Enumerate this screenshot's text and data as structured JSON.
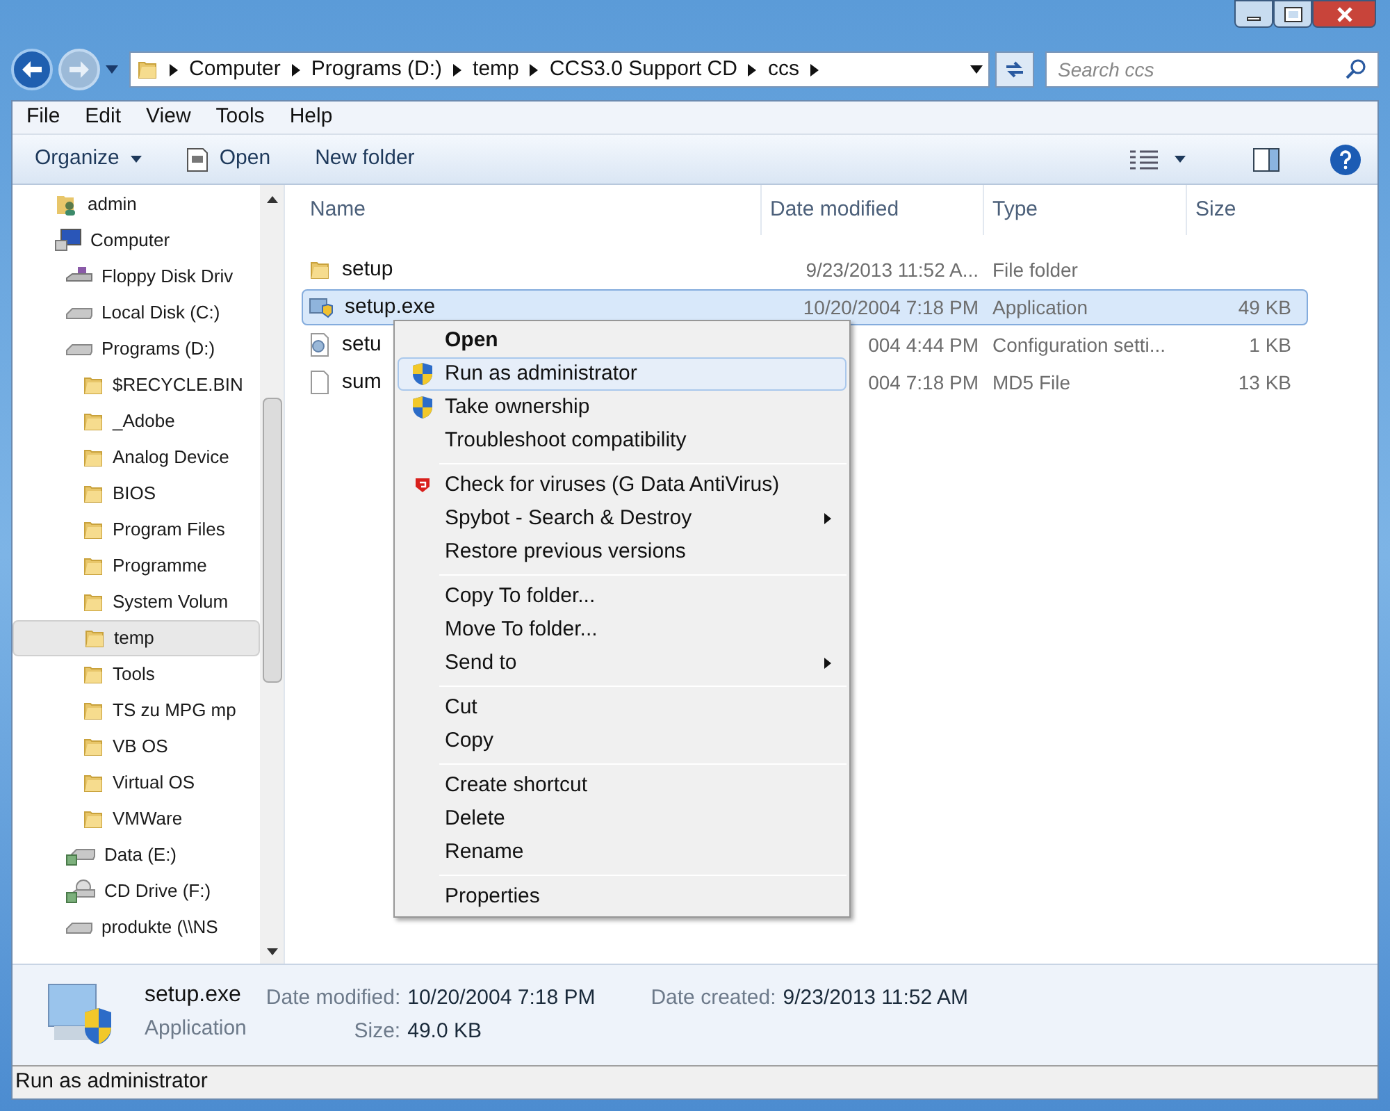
{
  "address_bar": {
    "crumbs": [
      "Computer",
      "Programs (D:)",
      "temp",
      "CCS3.0 Support CD",
      "ccs"
    ]
  },
  "search": {
    "placeholder": "Search ccs"
  },
  "menu_bar": [
    "File",
    "Edit",
    "View",
    "Tools",
    "Help"
  ],
  "toolbar": {
    "buttons": [
      {
        "label": "Organize",
        "kind": "dropdown"
      },
      {
        "label": "Open",
        "kind": "open"
      },
      {
        "label": "New folder",
        "kind": "plain"
      }
    ]
  },
  "navigation": {
    "items": [
      {
        "label": "admin",
        "kind": "user",
        "selected": false
      },
      {
        "label": "Computer",
        "kind": "computer",
        "selected": false,
        "children": [
          {
            "label": "Floppy Disk Driv",
            "kind": "floppy",
            "selected": false
          },
          {
            "label": "Local Disk (C:)",
            "kind": "drive",
            "selected": false
          },
          {
            "label": "Programs (D:)",
            "kind": "drive",
            "selected": false,
            "children": [
              {
                "label": "$RECYCLE.BIN",
                "kind": "folder",
                "selected": false
              },
              {
                "label": "_Adobe",
                "kind": "folder",
                "selected": false
              },
              {
                "label": "Analog Device",
                "kind": "folder",
                "selected": false
              },
              {
                "label": "BIOS",
                "kind": "folder",
                "selected": false
              },
              {
                "label": "Program Files",
                "kind": "folder",
                "selected": false
              },
              {
                "label": "Programme",
                "kind": "folder",
                "selected": false
              },
              {
                "label": "System Volum",
                "kind": "folder",
                "selected": false
              },
              {
                "label": "temp",
                "kind": "folder",
                "selected": true
              },
              {
                "label": "Tools",
                "kind": "folder",
                "selected": false
              },
              {
                "label": "TS zu MPG mp",
                "kind": "folder",
                "selected": false
              },
              {
                "label": "VB OS",
                "kind": "folder",
                "selected": false
              },
              {
                "label": "Virtual OS",
                "kind": "folder",
                "selected": false
              },
              {
                "label": "VMWare",
                "kind": "folder",
                "selected": false
              }
            ]
          },
          {
            "label": "Data (E:)",
            "kind": "netdrive",
            "selected": false
          },
          {
            "label": "CD Drive (F:)",
            "kind": "cd",
            "selected": false
          },
          {
            "label": "produkte (\\\\NS",
            "kind": "drive",
            "selected": false
          }
        ]
      }
    ]
  },
  "file_list": {
    "columns": [
      "Name",
      "Date modified",
      "Type",
      "Size"
    ],
    "rows": [
      {
        "name": "setup",
        "kind": "folder",
        "date": "9/23/2013 11:52 A...",
        "type": "File folder",
        "size": "",
        "selected": false
      },
      {
        "name": "setup.exe",
        "kind": "exe",
        "date": "10/20/2004 7:18 PM",
        "type": "Application",
        "size": "49 KB",
        "selected": true
      },
      {
        "name": "setu",
        "kind": "config",
        "date": "004 4:44 PM",
        "type": "Configuration setti...",
        "size": "1 KB",
        "selected": false
      },
      {
        "name": "sum",
        "kind": "file",
        "date": "004 7:18 PM",
        "type": "MD5 File",
        "size": "13 KB",
        "selected": false
      }
    ]
  },
  "context_menu": {
    "groups": [
      [
        {
          "label": "Open",
          "bold": true,
          "kind": "plain",
          "submenu": false,
          "selected": false
        },
        {
          "label": "Run as administrator",
          "bold": false,
          "kind": "shield",
          "submenu": false,
          "selected": true
        },
        {
          "label": "Take ownership",
          "bold": false,
          "kind": "shield",
          "submenu": false,
          "selected": false
        },
        {
          "label": "Troubleshoot compatibility",
          "bold": false,
          "kind": "plain",
          "submenu": false,
          "selected": false
        }
      ],
      [
        {
          "label": "Check for viruses (G Data AntiVirus)",
          "bold": false,
          "kind": "antivirus",
          "submenu": false,
          "selected": false
        },
        {
          "label": "Spybot - Search & Destroy",
          "bold": false,
          "kind": "plain",
          "submenu": true,
          "selected": false
        },
        {
          "label": "Restore previous versions",
          "bold": false,
          "kind": "plain",
          "submenu": false,
          "selected": false
        }
      ],
      [
        {
          "label": "Copy To folder...",
          "bold": false,
          "kind": "plain",
          "submenu": false,
          "selected": false
        },
        {
          "label": "Move To folder...",
          "bold": false,
          "kind": "plain",
          "submenu": false,
          "selected": false
        },
        {
          "label": "Send to",
          "bold": false,
          "kind": "plain",
          "submenu": true,
          "selected": false
        }
      ],
      [
        {
          "label": "Cut",
          "bold": false,
          "kind": "plain",
          "submenu": false,
          "selected": false
        },
        {
          "label": "Copy",
          "bold": false,
          "kind": "plain",
          "submenu": false,
          "selected": false
        }
      ],
      [
        {
          "label": "Create shortcut",
          "bold": false,
          "kind": "plain",
          "submenu": false,
          "selected": false
        },
        {
          "label": "Delete",
          "bold": false,
          "kind": "plain",
          "submenu": false,
          "selected": false
        },
        {
          "label": "Rename",
          "bold": false,
          "kind": "plain",
          "submenu": false,
          "selected": false
        }
      ],
      [
        {
          "label": "Properties",
          "bold": false,
          "kind": "plain",
          "submenu": false,
          "selected": false
        }
      ]
    ]
  },
  "details_pane": {
    "name": "setup.exe",
    "type": "Application",
    "fields": [
      {
        "label": "Date modified:",
        "value": "10/20/2004 7:18 PM"
      },
      {
        "label": "Size:",
        "value": "49.0 KB"
      },
      {
        "label": "Date created:",
        "value": "9/23/2013 11:52 AM"
      }
    ]
  },
  "status_bar": {
    "text": "Run as administrator"
  }
}
